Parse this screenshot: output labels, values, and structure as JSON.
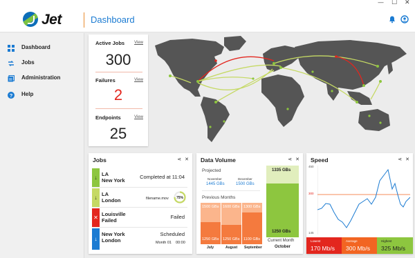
{
  "window": {
    "minimize": "—",
    "maximize": "☐",
    "close": "✕"
  },
  "header": {
    "logo_text": "Jet",
    "title": "Dashboard",
    "icons": [
      "bell-icon",
      "user-icon"
    ],
    "accent": "#1b7bd2"
  },
  "sidebar": {
    "items": [
      {
        "label": "Dashboard",
        "icon": "grid-icon"
      },
      {
        "label": "Jobs",
        "icon": "jobs-icon"
      },
      {
        "label": "Administration",
        "icon": "admin-icon"
      },
      {
        "label": "Help",
        "icon": "help-icon"
      }
    ]
  },
  "stats": {
    "active_jobs": {
      "title": "Active Jobs",
      "value": "300",
      "view": "View"
    },
    "failures": {
      "title": "Failures",
      "value": "2",
      "view": "View",
      "color": "#e3261e"
    },
    "endpoints": {
      "title": "Endpoints",
      "value": "25",
      "view": "View"
    }
  },
  "jobs": {
    "title": "Jobs",
    "rows": [
      {
        "from": "LA",
        "to": "New York",
        "status": "Completed at 11:04",
        "strip": "#8dc63f",
        "arrow": "↓"
      },
      {
        "from": "LA",
        "to": "London",
        "file": "filename.mov",
        "progress": "75%",
        "strip": "#c5d964",
        "arrow": "↓"
      },
      {
        "from": "Louisville",
        "to": "Failed",
        "status": "Failed",
        "strip": "#e3261e",
        "arrow": "✕"
      },
      {
        "from": "New York",
        "to": "London",
        "status": "Scheduled",
        "date": "Month 01",
        "time": "00:00",
        "strip": "#1b7bd2",
        "arrow": "↓"
      }
    ]
  },
  "data_volume": {
    "title": "Data Volume",
    "projected_label": "Projected",
    "projected": [
      {
        "month": "November",
        "value": "1445 GBs"
      },
      {
        "month": "December",
        "value": "1500 GBs"
      }
    ],
    "previous_label": "Previous Months",
    "previous": [
      {
        "month": "July",
        "top": "1500 GBs",
        "bottom": "1250 GBs"
      },
      {
        "month": "August",
        "top": "1600 GBs",
        "bottom": "1250 GBs"
      },
      {
        "month": "September",
        "top": "1300 GBs",
        "bottom": "1100 GBs"
      }
    ],
    "current": {
      "top": "1335 GBs",
      "bottom": "1250 GBs",
      "label": "Current Month",
      "month": "October"
    }
  },
  "speed": {
    "title": "Speed",
    "ymax": "450",
    "ymid": "300",
    "ymin": "145",
    "boxes": [
      {
        "caption": "Lowest",
        "value": "170 Mb/s",
        "color": "#e3261e"
      },
      {
        "caption": "Average",
        "value": "300 Mb/s",
        "color": "#f26522"
      },
      {
        "caption": "Highest",
        "value": "325 Mb/s",
        "color": "#8dc63f"
      }
    ]
  },
  "card_tools": {
    "share": "⋖",
    "close": "✕"
  }
}
